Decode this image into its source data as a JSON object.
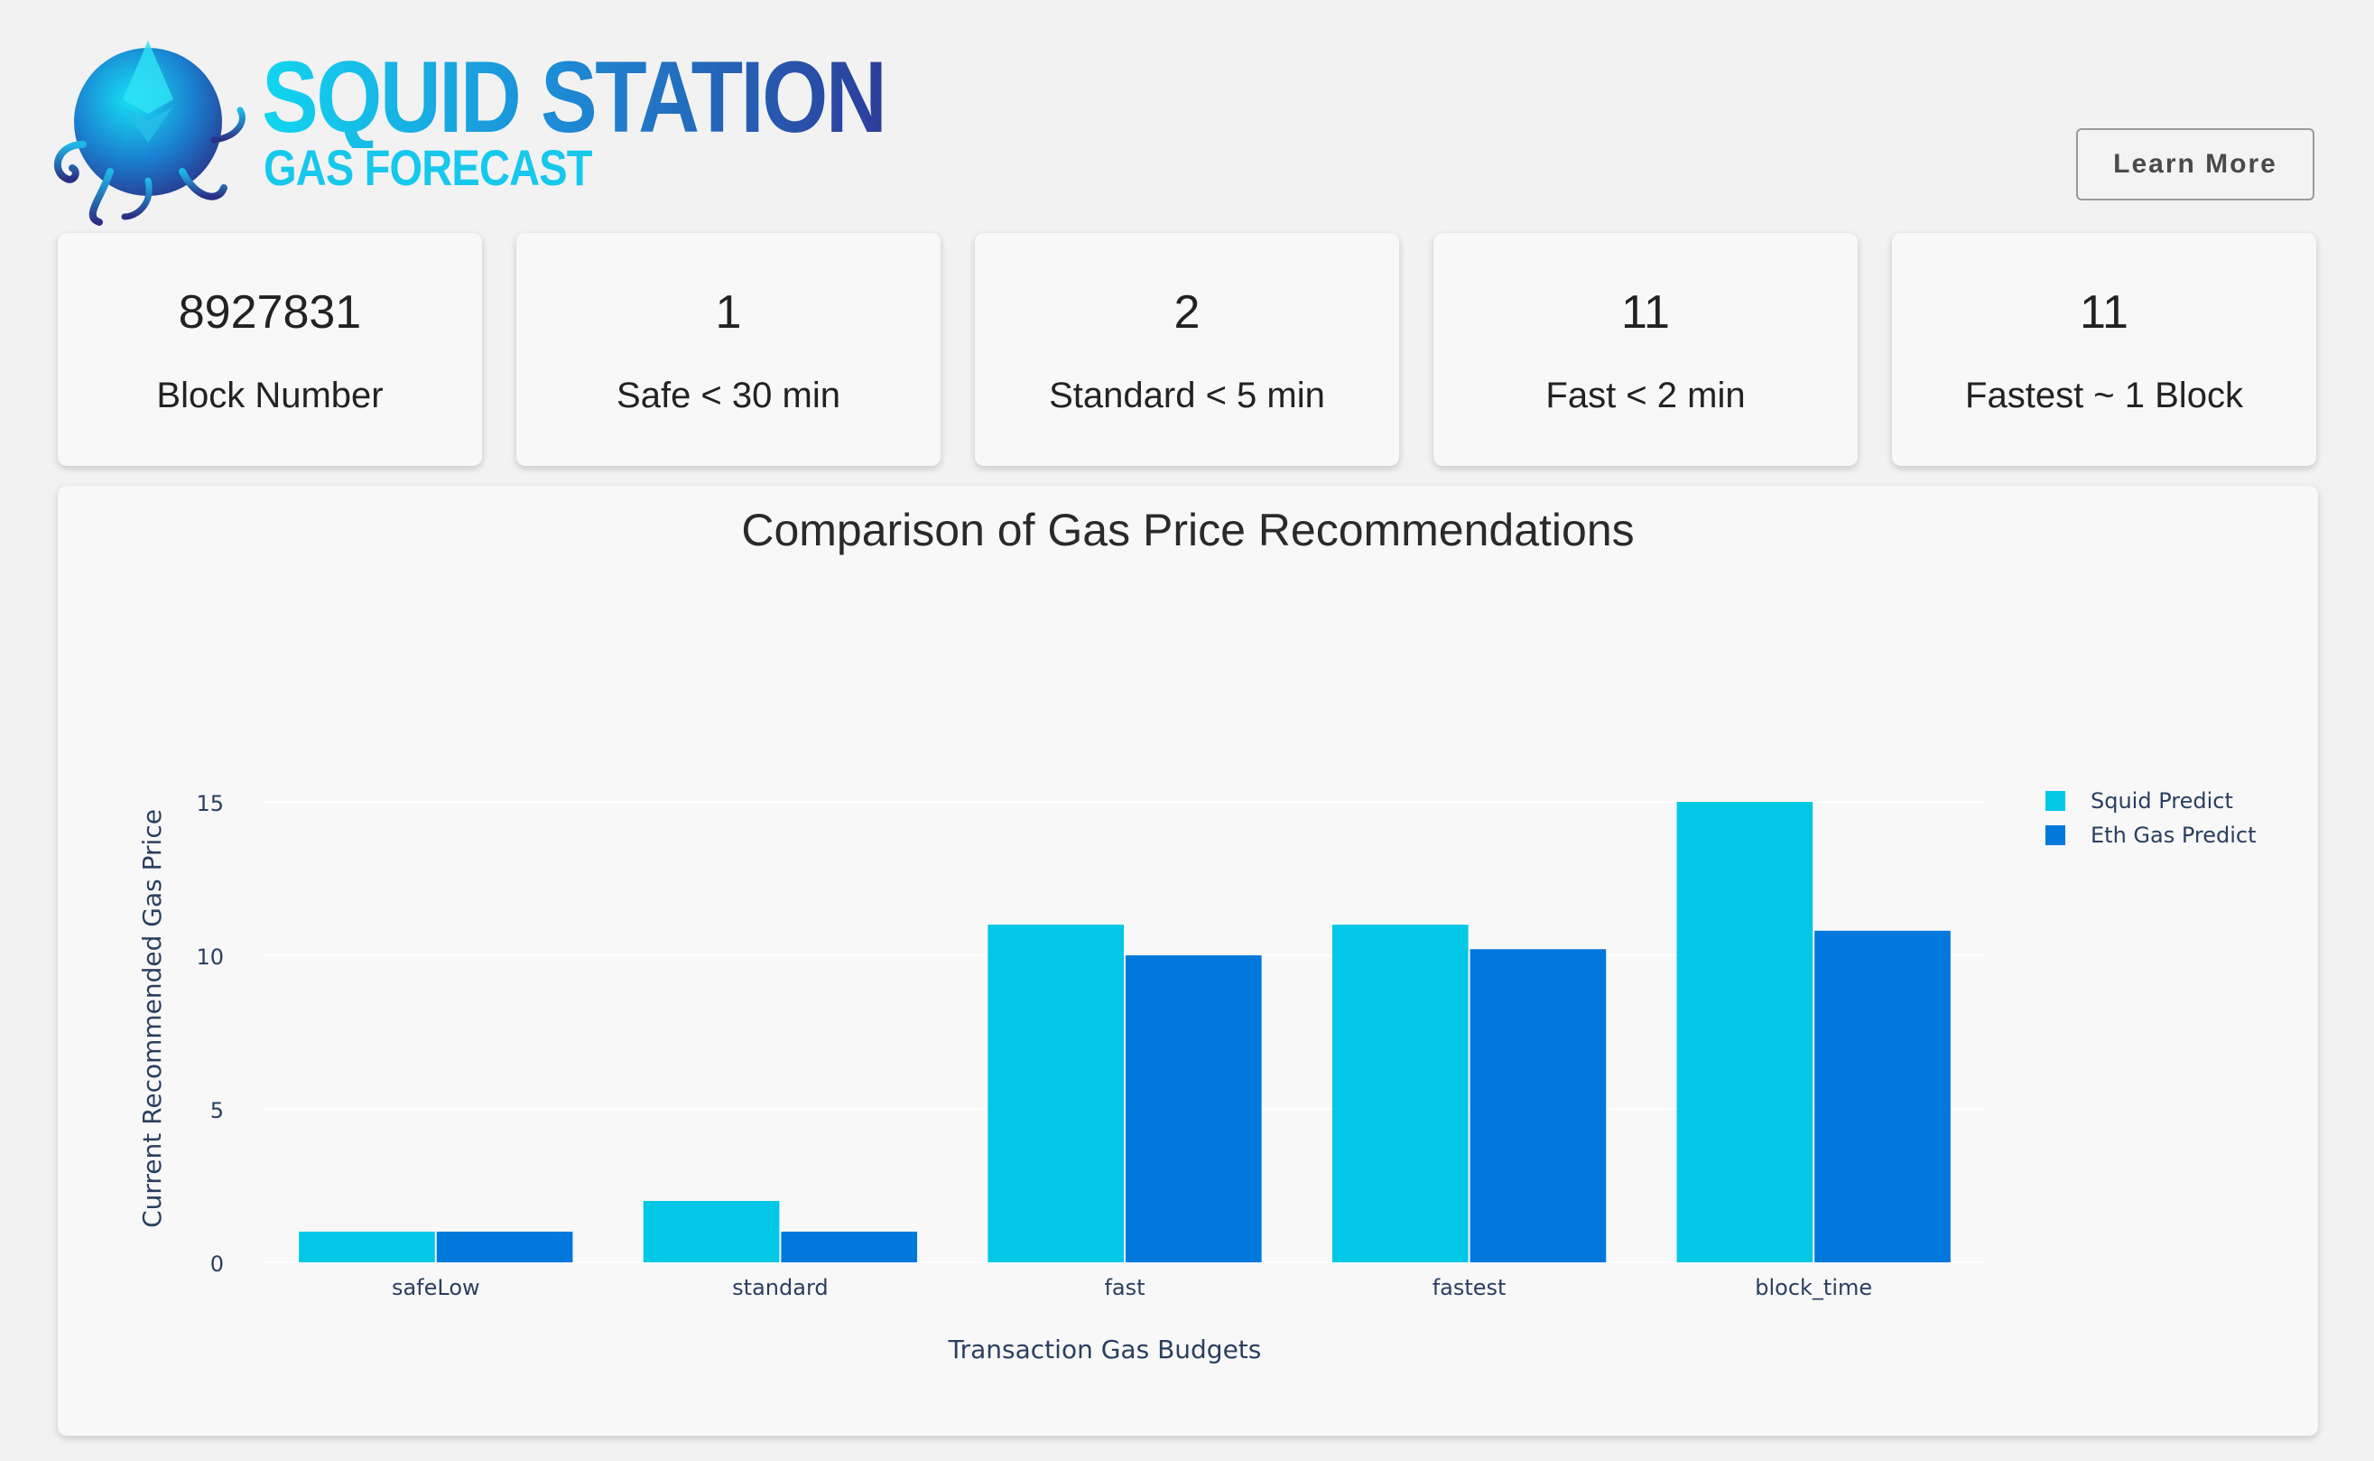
{
  "brand": {
    "title": "SQUID STATION",
    "subtitle": "GAS FORECAST",
    "logo_icon": "squid-ethereum-logo-icon"
  },
  "header": {
    "learn_more_label": "Learn More"
  },
  "stats": [
    {
      "value": "8927831",
      "label": "Block Number"
    },
    {
      "value": "1",
      "label": "Safe < 30 min"
    },
    {
      "value": "2",
      "label": "Standard < 5 min"
    },
    {
      "value": "11",
      "label": "Fast < 2 min"
    },
    {
      "value": "11",
      "label": "Fastest ~ 1 Block"
    }
  ],
  "colors": {
    "squid": "#00c8e6",
    "eth": "#0078dc",
    "gridline": "#ffffff",
    "axis_text": "#2a3f5f"
  },
  "chart_data": {
    "type": "bar",
    "title": "Comparison of Gas Price Recommendations",
    "xlabel": "Transaction Gas Budgets",
    "ylabel": "Current Recommended Gas Price",
    "categories": [
      "safeLow",
      "standard",
      "fast",
      "fastest",
      "block_time"
    ],
    "series": [
      {
        "name": "Squid Predict",
        "color": "#00c8e6",
        "values": [
          1,
          2,
          11,
          11,
          15
        ]
      },
      {
        "name": "Eth Gas Predict",
        "color": "#0078dc",
        "values": [
          1,
          1,
          10,
          10.2,
          10.8
        ]
      }
    ],
    "ylim": [
      0,
      15
    ],
    "yticks": [
      "0",
      "5",
      "10",
      "15"
    ],
    "grid": true,
    "legend_position": "top-right"
  }
}
